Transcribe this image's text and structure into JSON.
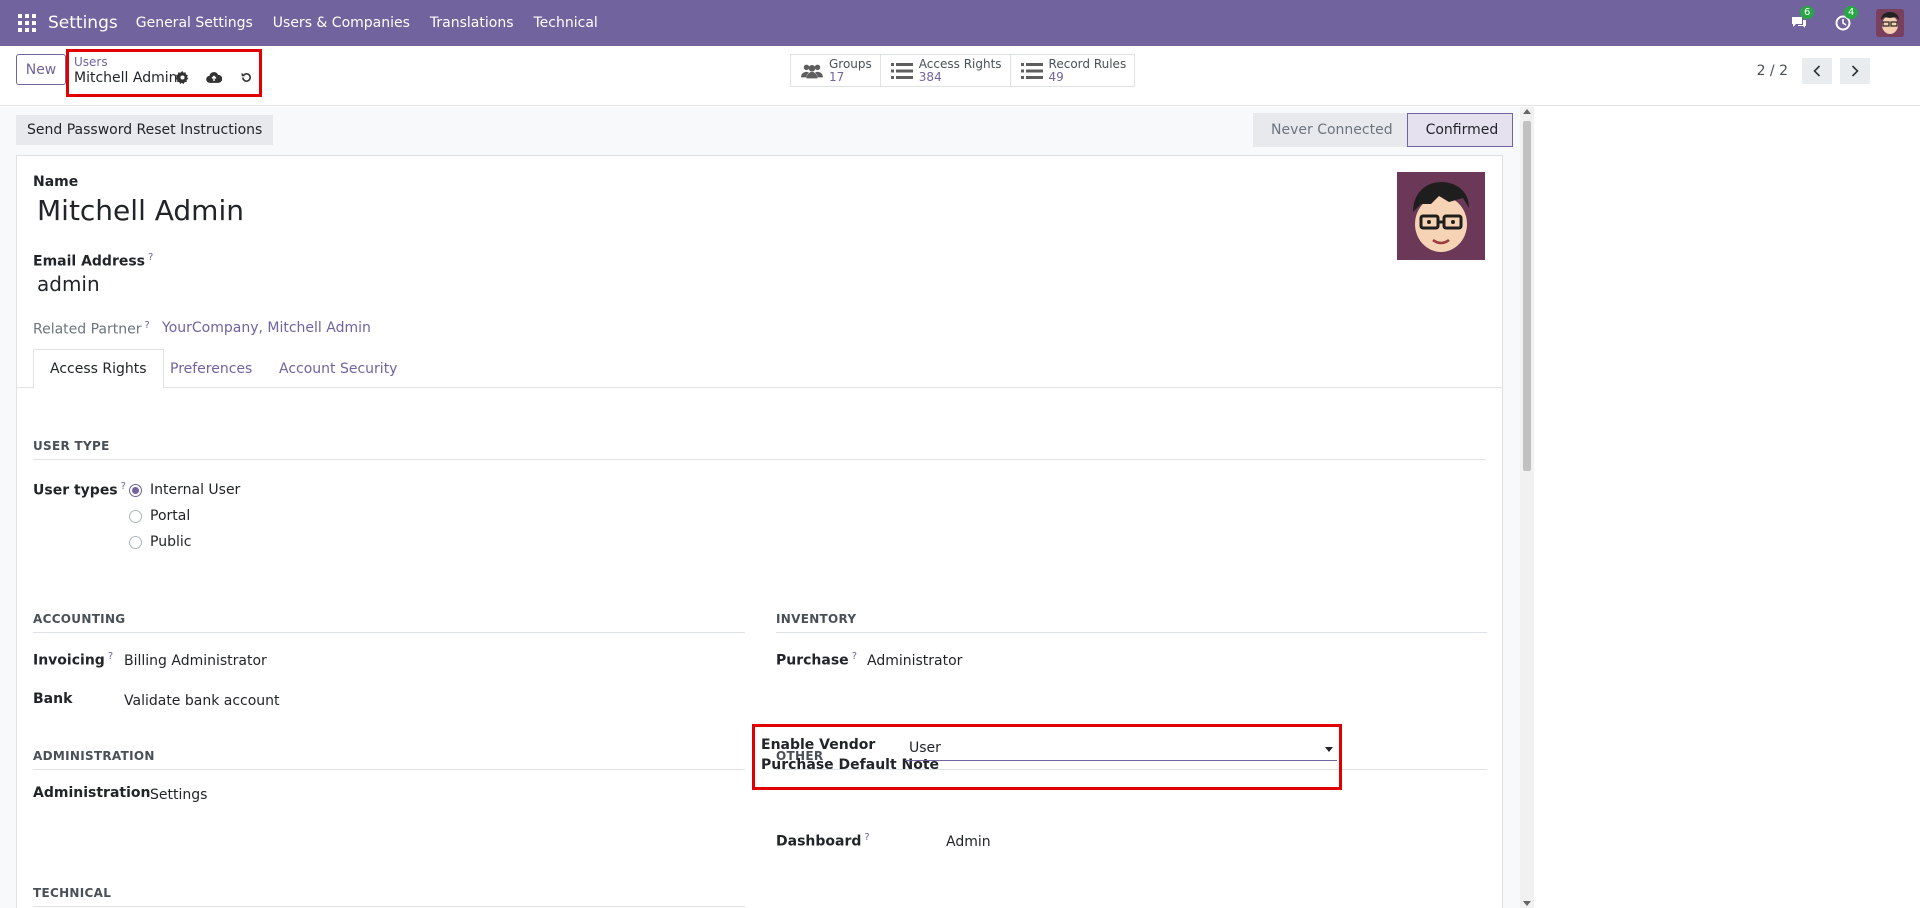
{
  "navbar": {
    "brand": "Settings",
    "menu": [
      "General Settings",
      "Users & Companies",
      "Translations",
      "Technical"
    ],
    "messages_count": "6",
    "activities_count": "4"
  },
  "breadcrumb": {
    "parent": "Users",
    "current": "Mitchell Admin"
  },
  "toolbar": {
    "new_label": "New"
  },
  "smart_buttons": [
    {
      "label": "Groups",
      "count": "17"
    },
    {
      "label": "Access Rights",
      "count": "384"
    },
    {
      "label": "Record Rules",
      "count": "49"
    }
  ],
  "pager": {
    "value": "2 / 2"
  },
  "header": {
    "reset_button": "Send Password Reset Instructions",
    "stages": [
      "Never Connected",
      "Confirmed"
    ]
  },
  "form": {
    "name_label": "Name",
    "name_value": "Mitchell Admin",
    "email_label": "Email Address",
    "email_value": "admin",
    "partner_label": "Related Partner",
    "partner_value": "YourCompany, Mitchell Admin"
  },
  "tabs": [
    "Access Rights",
    "Preferences",
    "Account Security"
  ],
  "user_type": {
    "section": "USER TYPE",
    "label": "User types",
    "options": [
      "Internal User",
      "Portal",
      "Public"
    ]
  },
  "accounting": {
    "section": "ACCOUNTING",
    "invoicing_label": "Invoicing",
    "invoicing_value": "Billing Administrator",
    "bank_label": "Bank",
    "bank_value": "Validate bank account"
  },
  "inventory": {
    "section": "INVENTORY",
    "purchase_label": "Purchase",
    "purchase_value": "Administrator"
  },
  "administration": {
    "section": "ADMINISTRATION",
    "label": "Administration",
    "value": "Settings"
  },
  "other": {
    "section": "OTHER",
    "vendor_label_1": "Enable Vendor",
    "vendor_label_2": "Purchase Default Note",
    "vendor_value": "User",
    "dashboard_label": "Dashboard",
    "dashboard_value": "Admin"
  },
  "technical": {
    "section": "TECHNICAL"
  },
  "colors": {
    "brand": "#71639e",
    "highlight": "#e00000"
  }
}
